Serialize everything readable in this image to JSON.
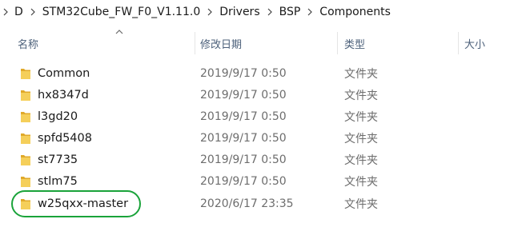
{
  "breadcrumb": {
    "items": [
      "D",
      "STM32Cube_FW_F0_V1.11.0",
      "Drivers",
      "BSP",
      "Components"
    ]
  },
  "columns": {
    "name": "名称",
    "date": "修改日期",
    "type": "类型",
    "size": "大小"
  },
  "rows": [
    {
      "name": "Common",
      "date": "2019/9/17 0:50",
      "type": "文件夹"
    },
    {
      "name": "hx8347d",
      "date": "2019/9/17 0:50",
      "type": "文件夹"
    },
    {
      "name": "l3gd20",
      "date": "2019/9/17 0:50",
      "type": "文件夹"
    },
    {
      "name": "spfd5408",
      "date": "2019/9/17 0:50",
      "type": "文件夹"
    },
    {
      "name": "st7735",
      "date": "2019/9/17 0:50",
      "type": "文件夹"
    },
    {
      "name": "stlm75",
      "date": "2019/9/17 0:50",
      "type": "文件夹"
    },
    {
      "name": "w25qxx-master",
      "date": "2020/6/17 23:35",
      "type": "文件夹"
    }
  ],
  "icons": {
    "folder": "folder-icon",
    "separator": "chevron-right-icon",
    "sort": "sort-ascending-icon"
  },
  "colors": {
    "folder": "#f2c94c",
    "folder_dark": "#e0a92a",
    "highlight": "#1aa33a",
    "header_text": "#4c607a"
  }
}
